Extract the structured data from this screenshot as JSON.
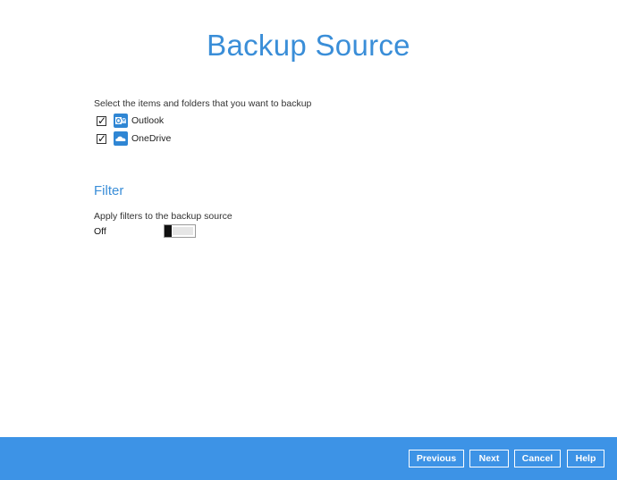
{
  "page": {
    "title": "Backup Source"
  },
  "source": {
    "instruction": "Select the items and folders that you want to backup",
    "items": [
      {
        "label": "Outlook",
        "checked": true,
        "icon": "outlook-icon"
      },
      {
        "label": "OneDrive",
        "checked": true,
        "icon": "onedrive-icon"
      }
    ]
  },
  "filter": {
    "heading": "Filter",
    "description": "Apply filters to the backup source",
    "toggle_state": "Off",
    "enabled": false
  },
  "footer": {
    "previous_label": "Previous",
    "next_label": "Next",
    "cancel_label": "Cancel",
    "help_label": "Help"
  },
  "colors": {
    "accent": "#3a8ed8",
    "footer_bg": "#3d93e6",
    "icon_bg": "#2f86d4"
  }
}
